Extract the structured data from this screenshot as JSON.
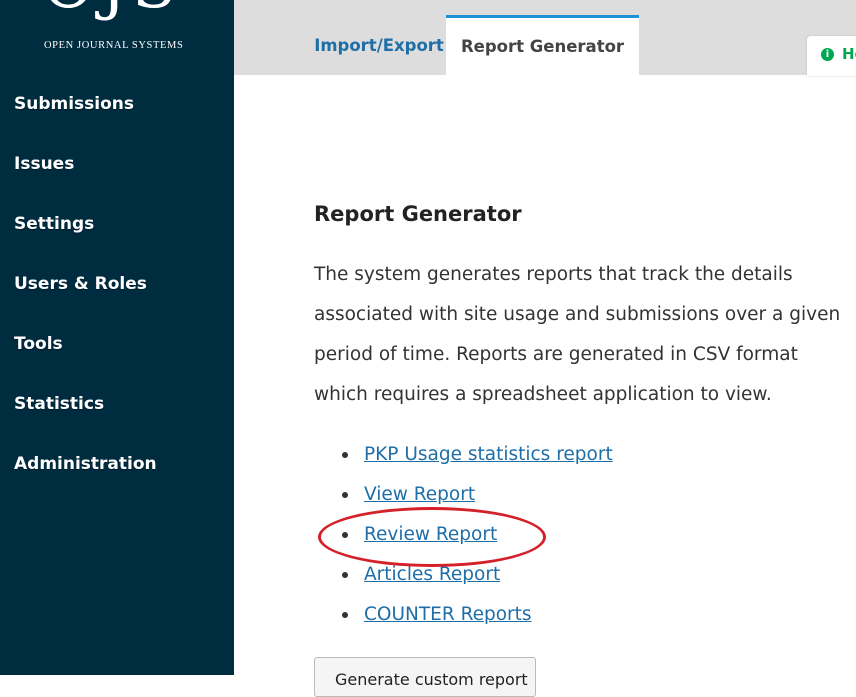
{
  "sidebar": {
    "logo_mark": "OJS",
    "logo_subtitle": "OPEN JOURNAL SYSTEMS",
    "items": [
      {
        "label": "Submissions"
      },
      {
        "label": "Issues"
      },
      {
        "label": "Settings"
      },
      {
        "label": "Users & Roles"
      },
      {
        "label": "Tools"
      },
      {
        "label": "Statistics"
      },
      {
        "label": "Administration"
      }
    ]
  },
  "tabs": [
    {
      "label": "Import/Export"
    },
    {
      "label": "Report Generator"
    }
  ],
  "help": {
    "label": "He",
    "icon": "info-icon"
  },
  "main": {
    "heading": "Report Generator",
    "description": "The system generates reports that track the details associated with site usage and submissions over a given period of time. Reports are generated in CSV format which requires a spreadsheet application to view.",
    "reports": [
      {
        "label": "PKP Usage statistics report"
      },
      {
        "label": "View Report"
      },
      {
        "label": "Review Report"
      },
      {
        "label": "Articles Report"
      },
      {
        "label": "COUNTER Reports"
      }
    ],
    "button_label": "Generate custom report"
  },
  "colors": {
    "sidebar": "#002c40",
    "link": "#1e6ea7",
    "tab_accent": "#1e90d6",
    "highlight": "#d42028",
    "help": "#00a651"
  }
}
